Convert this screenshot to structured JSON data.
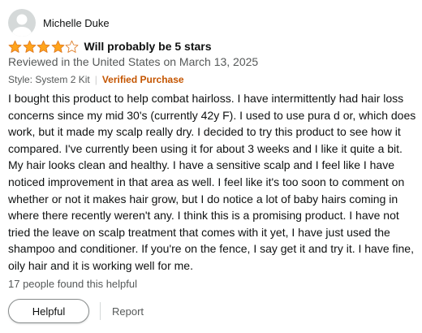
{
  "author": {
    "name": "Michelle Duke",
    "avatar_icon": "default-avatar-icon"
  },
  "rating": {
    "value": 4,
    "max": 5,
    "icon": "star-icon",
    "color": "#ffa41c",
    "empty_color": "#ffffff"
  },
  "title": "Will probably be 5 stars",
  "date_line": "Reviewed in the United States on March 13, 2025",
  "meta": {
    "style": "Style: System 2 Kit",
    "separator": "|",
    "verified": "Verified Purchase",
    "verified_color": "#c45500"
  },
  "body": "I bought this product to help combat hairloss. I have intermittently had hair loss concerns since my mid 30's (currently 42y F). I used to use pura d or, which does work, but it made my scalp really dry. I decided to try this product to see how it compared. I've currently been using it for about 3 weeks and I like it quite a bit. My hair looks clean and healthy. I have a sensitive scalp and I feel like I have noticed improvement in that area as well. I feel like it's too soon to comment on whether or not it makes hair grow, but I do notice a lot of baby hairs coming in where there recently weren't any. I think this is a promising product. I have not tried the leave on scalp treatment that comes with it yet, I have just used the shampoo and conditioner. If you're on the fence, I say get it and try it. I have fine, oily hair and it is working well for me.",
  "helpful_count": "17 people found this helpful",
  "actions": {
    "helpful_label": "Helpful",
    "report_label": "Report"
  }
}
